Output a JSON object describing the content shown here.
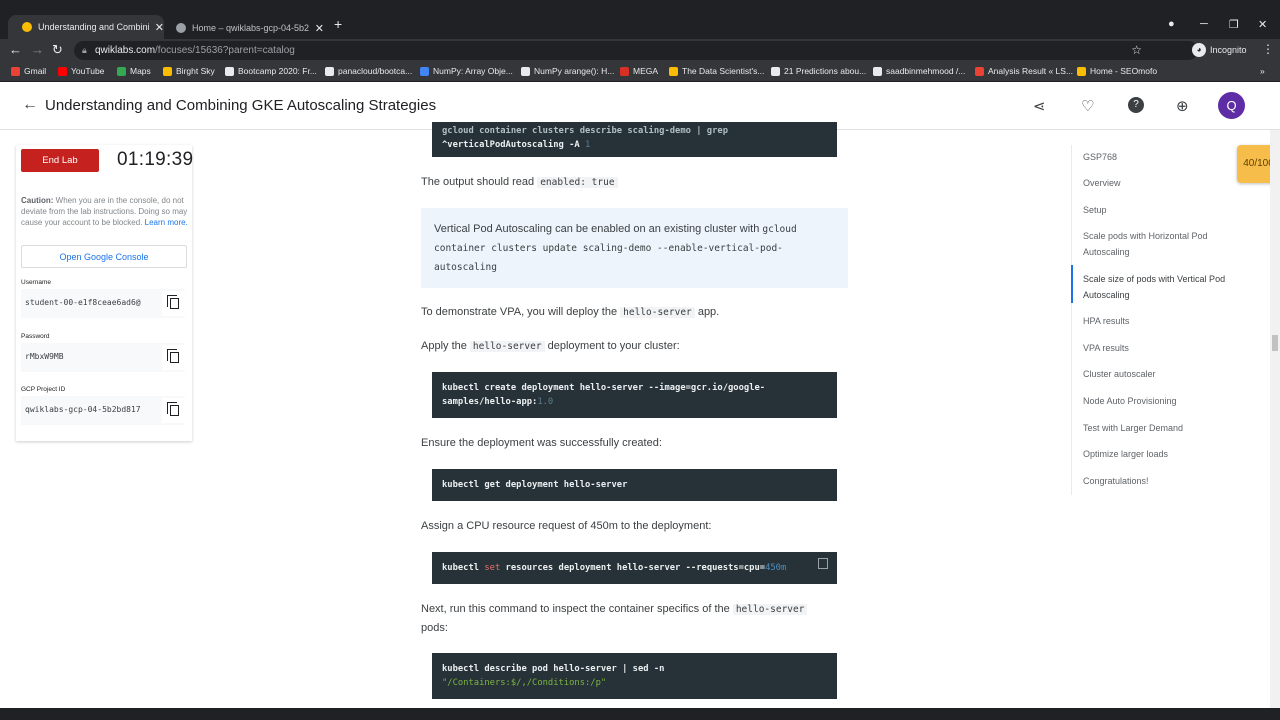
{
  "browser": {
    "tabs": [
      {
        "title": "Understanding and Combining GKE",
        "active": true
      },
      {
        "title": "Home – qwiklabs-gcp-04-5b2...",
        "active": false
      }
    ],
    "new_tab": "+",
    "url_host": "qwiklabs.com",
    "url_path": "/focuses/15636?parent=catalog",
    "profile": "Incognito",
    "bookmarks": [
      "Gmail",
      "YouTube",
      "Maps",
      "Birght Sky",
      "Bootcamp 2020: Fr...",
      "panacloud/bootca...",
      "NumPy: Array Obje...",
      "NumPy arange(): H...",
      "MEGA",
      "The Data Scientist's...",
      "21 Predictions abou...",
      "saadbinmehmood /...",
      "Analysis Result « LS...",
      "Home - SEOmofo"
    ],
    "bookmark_colors": [
      "#ea4335",
      "#ff0000",
      "#34a853",
      "#fbbc04",
      "#e8eaed",
      "#e8eaed",
      "#4285f4",
      "#e8eaed",
      "#d93025",
      "#fbbc04",
      "#e8eaed",
      "#e8eaed",
      "#ea4335",
      "#fbbc04"
    ]
  },
  "header": {
    "title": "Understanding and Combining GKE Autoscaling Strategies",
    "icons": [
      "share-icon",
      "heart-icon",
      "help-icon",
      "globe-icon"
    ],
    "avatar_letter": "Q"
  },
  "lab_panel": {
    "end_lab": "End Lab",
    "timer": "01:19:39",
    "caution_bold": "Caution:",
    "caution_text": " When you are in the console, do not deviate from the lab instructions. Doing so may cause your account to be blocked. ",
    "learn_more": "Learn more.",
    "console_button": "Open Google Console",
    "username_label": "Username",
    "username": "student-00-e1f8ceae6ad6@",
    "password_label": "Password",
    "password": "rMbxW9MB",
    "project_label": "GCP Project ID",
    "project_id": "qwiklabs-gcp-04-5b2bd817"
  },
  "content": {
    "code0_line1": "gcloud container clusters describe scaling-demo | grep",
    "code0_line2": "^verticalPodAutoscaling -A ",
    "code0_num": "1",
    "p1_text": "The output should read ",
    "p1_code": "enabled: true",
    "note_text": "Vertical Pod Autoscaling can be enabled on an existing cluster with ",
    "note_code": "gcloud container clusters update scaling-demo --enable-vertical-pod-autoscaling",
    "p2_a": "To demonstrate VPA, you will deploy the ",
    "p2_code": "hello-server",
    "p2_b": " app.",
    "p3_a": "Apply the ",
    "p3_code": "hello-server",
    "p3_b": " deployment to your cluster:",
    "code1_line1": "kubectl create deployment hello-server --image=gcr.io/google-",
    "code1_line2": "samples/hello-app:",
    "code1_num": "1.0",
    "p4": "Ensure the deployment was successfully created:",
    "code2": "kubectl get deployment hello-server",
    "p5": "Assign a CPU resource request of 450m to the deployment:",
    "code3_a": "kubectl ",
    "code3_kw": "set",
    "code3_b": " resources deployment hello-server --requests=cpu=",
    "code3_num": "450m",
    "p6_a": "Next, run this command to inspect the container specifics of the ",
    "p6_code": "hello-server",
    "p6_b": "pods:",
    "code4_line1": "kubectl describe pod hello-server | sed -n",
    "code4_line2": "\"/Containers:$/,/Conditions:/p\""
  },
  "toc": {
    "items": [
      "GSP768",
      "Overview",
      "Setup",
      "Scale pods with Horizontal Pod Autoscaling",
      "Scale size of pods with Vertical Pod Autoscaling",
      "HPA results",
      "VPA results",
      "Cluster autoscaler",
      "Node Auto Provisioning",
      "Test with Larger Demand",
      "Optimize larger loads",
      "Congratulations!"
    ],
    "active_index": 4,
    "score": "40/100"
  }
}
